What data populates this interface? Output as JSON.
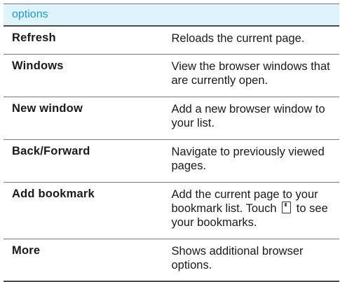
{
  "header": {
    "title": "options"
  },
  "rows": [
    {
      "name": "Refresh",
      "description": "Reloads the current page."
    },
    {
      "name": "Windows",
      "description": "View the browser windows that are currently open."
    },
    {
      "name": "New window",
      "description": "Add a new browser window to your list."
    },
    {
      "name": "Back/Forward",
      "description": "Navigate to previously viewed pages."
    },
    {
      "name": "Add bookmark",
      "description_before": "Add the current page to your bookmark list. Touch",
      "icon": "bookmark-icon",
      "description_after": "to see your bookmarks."
    },
    {
      "name": "More",
      "description": "Shows additional browser options."
    }
  ],
  "colors": {
    "header_background": "#dff3fb",
    "header_text": "#1a9bd7",
    "rule": "#7a7a7a"
  }
}
